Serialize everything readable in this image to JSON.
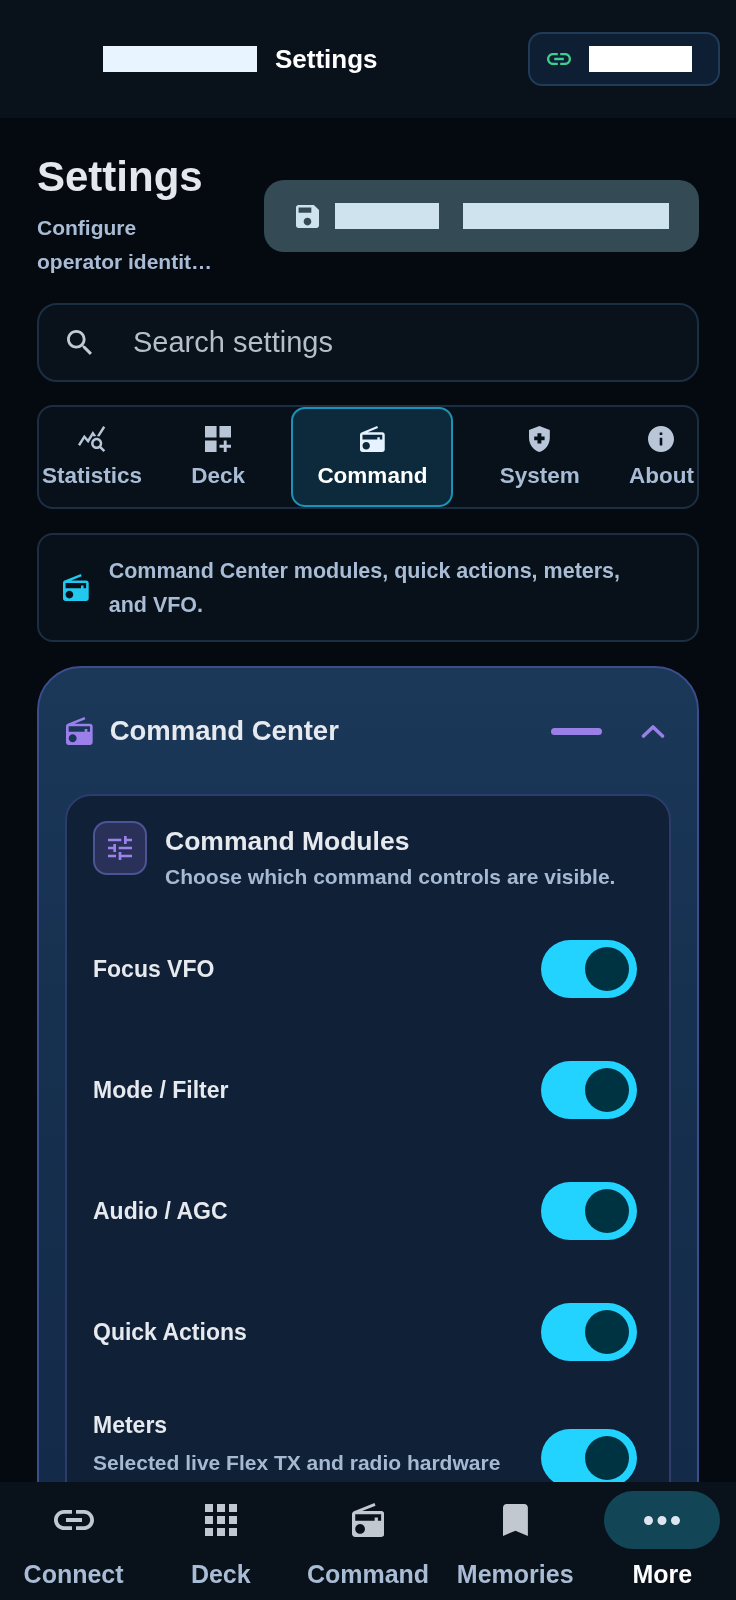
{
  "app_bar": {
    "title": "Settings"
  },
  "page": {
    "title": "Settings",
    "subtitle": "Configure operator identit…"
  },
  "search": {
    "placeholder": "Search settings"
  },
  "tabs": [
    {
      "label": "Statistics",
      "selected": false
    },
    {
      "label": "Deck",
      "selected": false
    },
    {
      "label": "Command",
      "selected": true
    },
    {
      "label": "System",
      "selected": false
    },
    {
      "label": "About",
      "selected": false
    }
  ],
  "info_banner": {
    "text": "Command Center modules, quick actions, meters, and VFO."
  },
  "section": {
    "title": "Command Center",
    "expanded": true,
    "group": {
      "title": "Command Modules",
      "description": "Choose which command controls are visible.",
      "toggles": [
        {
          "label": "Focus VFO",
          "on": true
        },
        {
          "label": "Mode / Filter",
          "on": true
        },
        {
          "label": "Audio / AGC",
          "on": true
        },
        {
          "label": "Quick Actions",
          "on": true
        },
        {
          "label": "Meters",
          "description": "Selected live Flex TX and radio hardware",
          "on": true
        }
      ]
    }
  },
  "bottom_nav": [
    {
      "label": "Connect",
      "selected": false
    },
    {
      "label": "Deck",
      "selected": false
    },
    {
      "label": "Command",
      "selected": false
    },
    {
      "label": "Memories",
      "selected": false
    },
    {
      "label": "More",
      "selected": true
    }
  ]
}
